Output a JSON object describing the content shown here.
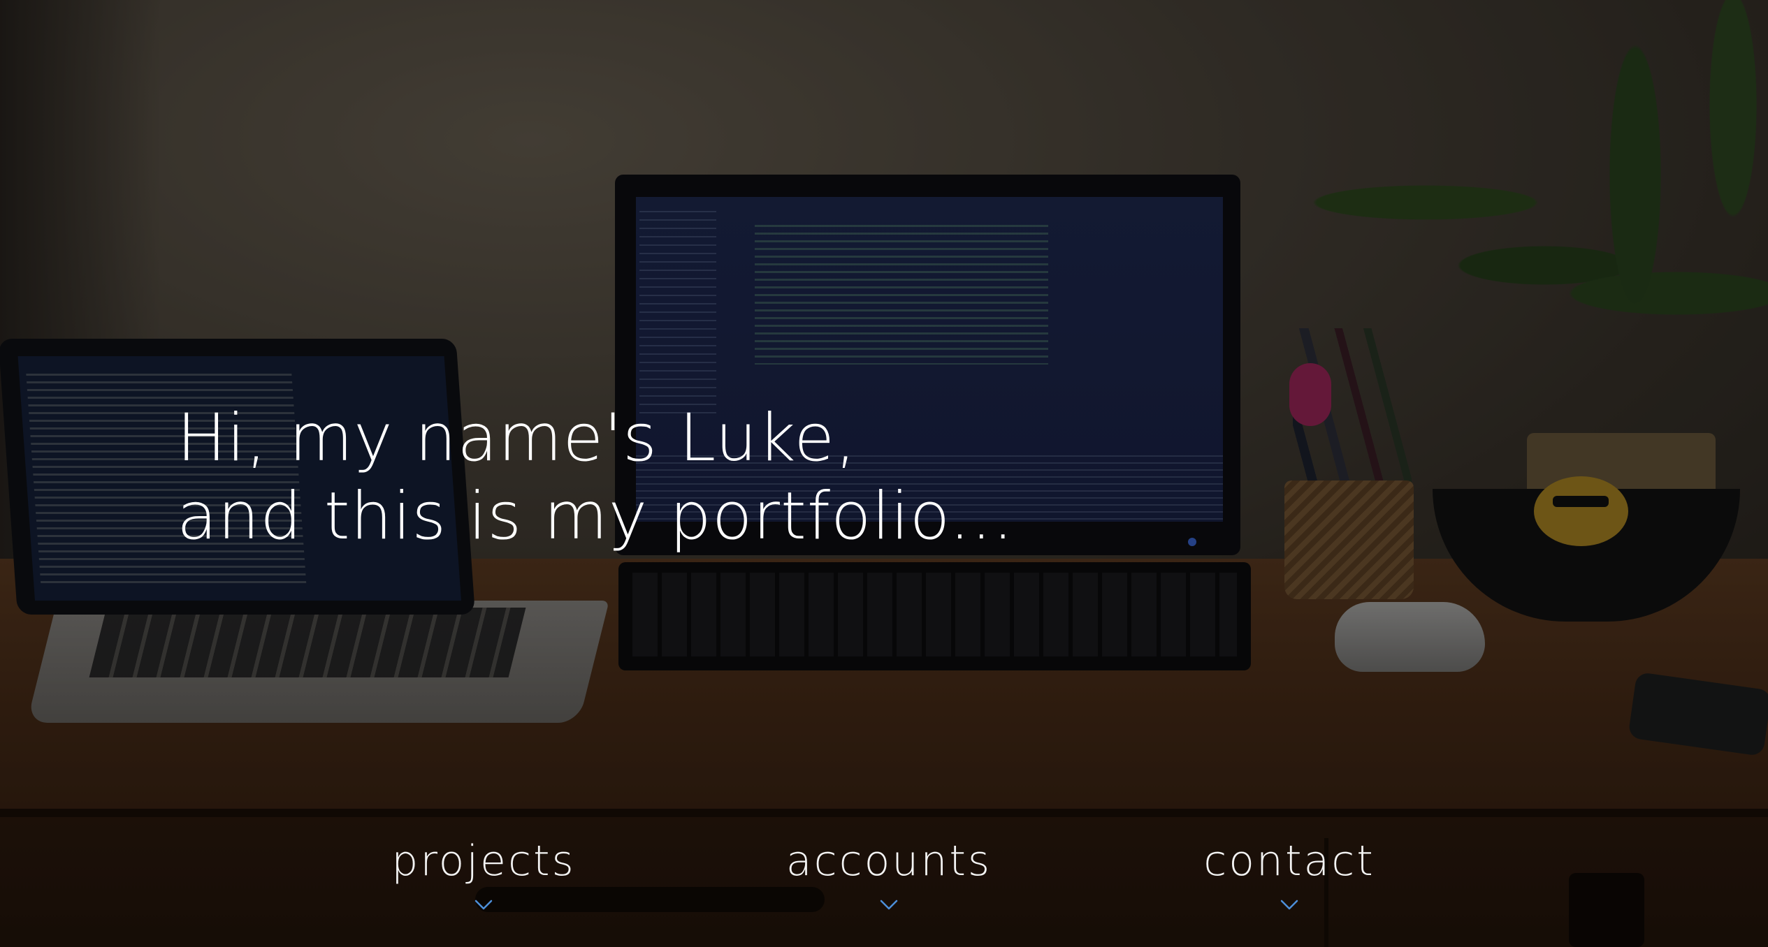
{
  "hero": {
    "headline_line1": "Hi, my name's Luke,",
    "headline_line2": "and this is my portfolio..."
  },
  "nav": {
    "items": [
      {
        "label": "projects",
        "icon": "chevron-down-icon"
      },
      {
        "label": "accounts",
        "icon": "chevron-down-icon"
      },
      {
        "label": "contact",
        "icon": "chevron-down-icon"
      }
    ]
  },
  "colors": {
    "text": "#ffffff",
    "chevron": "#4d8fd9",
    "overlay": "rgba(0,0,0,0.38)"
  }
}
